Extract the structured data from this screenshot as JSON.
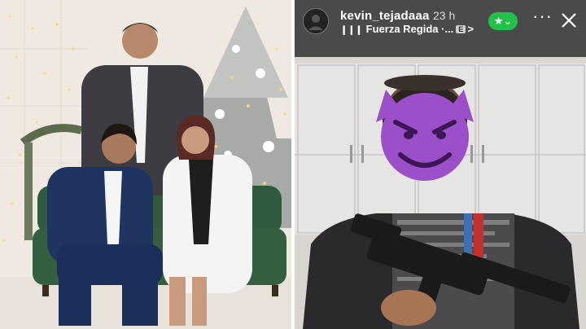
{
  "story": {
    "username": "kevin_tejadaaa",
    "timestamp": "23 h",
    "music": {
      "icon": "music-bars-icon",
      "title": "Fuerza Regida ·...",
      "badge": "E",
      "chevron": ">"
    },
    "favorite_badge": {
      "icon": "star-chevron-icon",
      "color": "#22c24a"
    },
    "more_icon": "more-horizontal-icon",
    "close_icon": "close-icon"
  },
  "colors": {
    "header_bg": "#4a4a4a",
    "favorite_green": "#22c24a"
  }
}
